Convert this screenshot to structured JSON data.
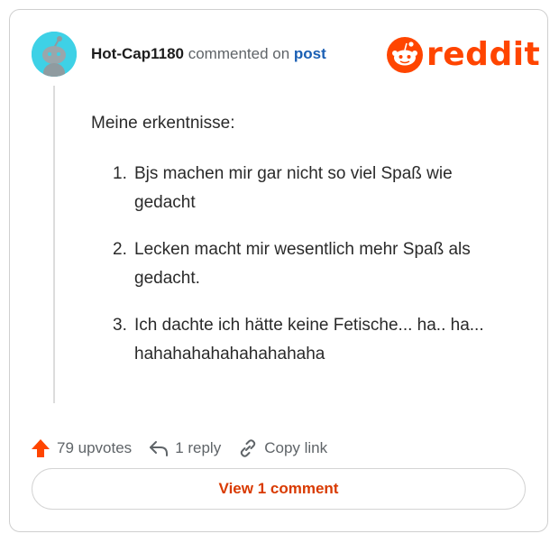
{
  "header": {
    "username": "Hot-Cap1180",
    "commented_text": "commented on",
    "post_link": "post",
    "logo_text": "reddit"
  },
  "comment": {
    "intro": "Meine erkentnisse:",
    "items": [
      {
        "number": "1.",
        "text": "Bjs machen mir gar nicht so viel Spaß wie gedacht"
      },
      {
        "number": "2.",
        "text": "Lecken macht mir wesentlich mehr Spaß als gedacht."
      },
      {
        "number": "3.",
        "text": "Ich dachte ich hätte keine Fetische... ha.. ha... hahahahahahahahahaha"
      }
    ]
  },
  "actions": {
    "upvotes": "79 upvotes",
    "reply": "1 reply",
    "copy_link": "Copy link"
  },
  "view_button": "View 1 comment",
  "colors": {
    "brand": "#ff4500",
    "link": "#1a5fb4",
    "avatar": "#3ed1e6",
    "view_button_text": "#d93a00"
  },
  "icons": {
    "avatar": "snoo-avatar",
    "logo": "reddit-snoo-icon",
    "upvote": "upvote-arrow-icon",
    "reply": "reply-arrow-icon",
    "copy": "link-icon"
  }
}
